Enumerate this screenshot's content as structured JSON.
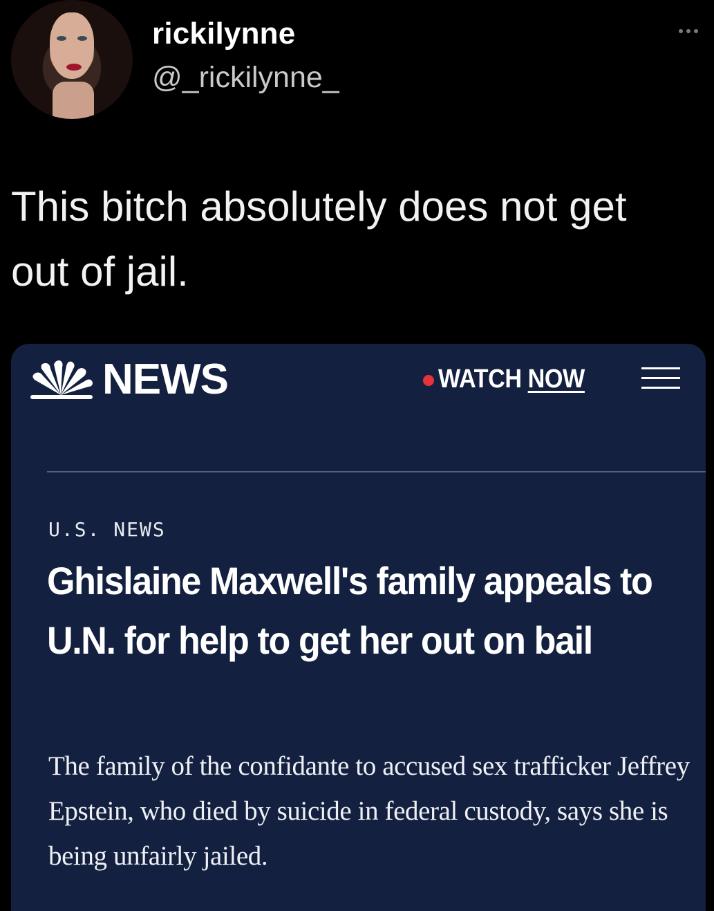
{
  "tweet": {
    "display_name": "rickilynne",
    "handle": "@_rickilynne_",
    "text": "This bitch absolutely does not get out of jail.",
    "more_icon": "more-horizontal-icon"
  },
  "card": {
    "brand": "NEWS",
    "logo_icon": "peacock-logo-icon",
    "watch": "WATCH",
    "now": "NOW",
    "menu_icon": "menu-icon",
    "section": "U.S. NEWS",
    "headline": "Ghislaine Maxwell's family appeals to U.N. for help to get her out on bail",
    "dek": "The family of the confidante to accused sex trafficker Jeffrey Epstein, who died by suicide in federal custody, says she is being unfairly jailed.",
    "colors": {
      "background": "#13203f",
      "live_dot": "#e5333b"
    }
  }
}
